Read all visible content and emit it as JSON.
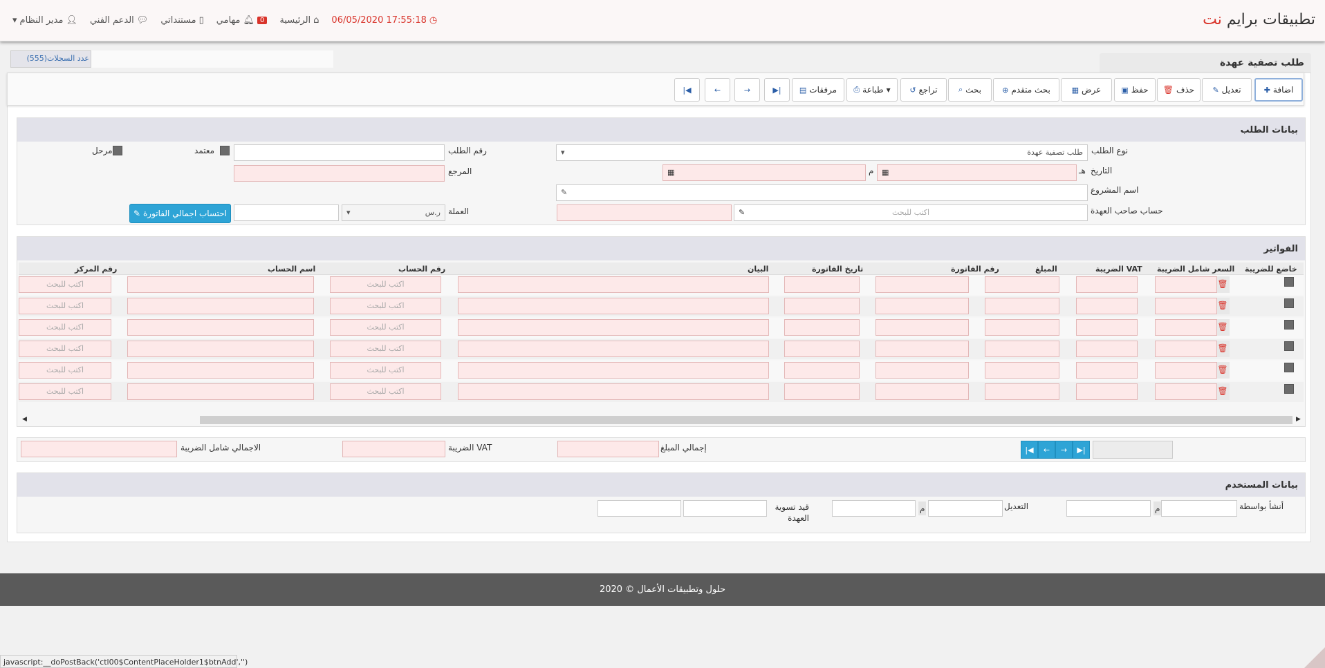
{
  "app": {
    "brand_main": "تطبيقات برايم",
    "brand_accent": "نت"
  },
  "topnav": {
    "datetime": "17:55:18 06/05/2020",
    "home": "الرئيسية",
    "tasks_count": "0",
    "tasks": "مهامي",
    "docs": "مستنداتي",
    "support": "الدعم الفني",
    "user": "مدير النظام"
  },
  "records_count": "عدد السجلات(555)",
  "page_title": "طلب تصفية عهدة",
  "toolbar": {
    "add": "اضافة",
    "edit": "تعديل",
    "delete": "حذف",
    "save": "حفظ",
    "view": "عرض",
    "advanced_search": "بحث متقدم",
    "search": "بحث",
    "undo": "تراجع",
    "print": "طباعة",
    "attachments": "مرفقات"
  },
  "request_panel": {
    "title": "بيانات الطلب",
    "request_type_label": "نوع الطلب",
    "request_type_value": "طلب تصفية عهدة",
    "request_no_label": "رقم الطلب",
    "approved_label": "معتمد",
    "posted_label": "مرحل",
    "date_label": "التاريخ",
    "hijri_marker": "هـ",
    "gregorian_marker": "م",
    "reference_label": "المرجع",
    "project_label": "اسم المشروع",
    "custody_account_label": "حساب صاحب العهدة",
    "search_placeholder": "اكتب للبحث",
    "currency_label": "العملة",
    "currency_value": "ر.س",
    "calc_button": "احتساب اجمالي الفاتورة"
  },
  "invoices_panel": {
    "title": "الفواتير",
    "columns": {
      "taxable": "خاضع للضريبة",
      "price_incl_tax": "السعر شامل الضريبة",
      "vat": "الضريبة VAT",
      "amount": "المبلغ",
      "invoice_no": "رقم الفاتورة",
      "invoice_date": "تاريخ الفاتورة",
      "description": "البيان",
      "account_no": "رقم الحساب",
      "account_name": "اسم الحساب",
      "center_no": "رقم المركز"
    },
    "row_placeholder": "اكتب للبحث",
    "rows": [
      1,
      2,
      3,
      4,
      5,
      6
    ]
  },
  "totals": {
    "total_amount": "إجمالي المبلغ",
    "vat": "الضريبة VAT",
    "total_incl_tax": "الاجمالي شامل الضريبة"
  },
  "user_panel": {
    "title": "بيانات المستخدم",
    "created_by": "أنشأ بواسطة",
    "modified": "التعديل",
    "custody_settlement": "قيد تسوية العهدة",
    "gregorian_marker": "م"
  },
  "footer": "2020 © حلول وتطبيقات الأعمال",
  "statusbar": "javascript:__doPostBack('ctl00$ContentPlaceHolder1$btnAdd','')"
}
